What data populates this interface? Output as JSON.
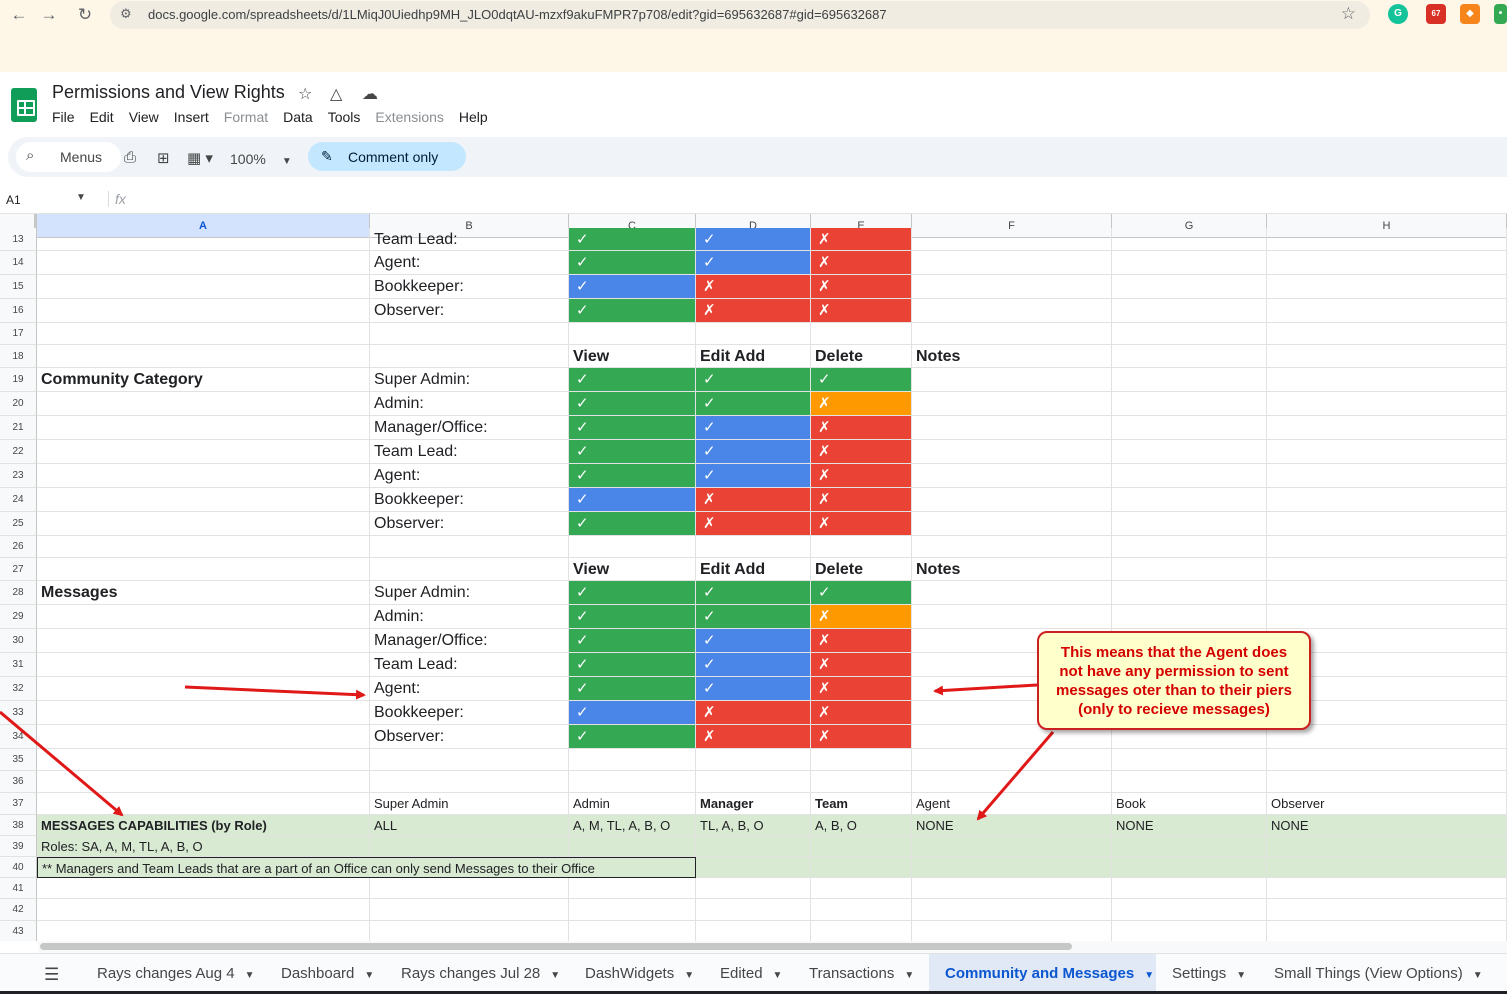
{
  "browser": {
    "url": "docs.google.com/spreadsheets/d/1LMiqJ0Uiedhp9MH_JLO0dqtAU-mzxf9akuFMPR7p708/edit?gid=695632687#gid=695632687",
    "ext_badge": "67"
  },
  "doc": {
    "title": "Permissions and View Rights",
    "menus": [
      {
        "label": "File",
        "enabled": true
      },
      {
        "label": "Edit",
        "enabled": true
      },
      {
        "label": "View",
        "enabled": true
      },
      {
        "label": "Insert",
        "enabled": true
      },
      {
        "label": "Format",
        "enabled": false
      },
      {
        "label": "Data",
        "enabled": true
      },
      {
        "label": "Tools",
        "enabled": true
      },
      {
        "label": "Extensions",
        "enabled": false
      },
      {
        "label": "Help",
        "enabled": true
      }
    ]
  },
  "toolbar": {
    "search_label": "Menus",
    "zoom": "100%",
    "mode_label": "Comment only"
  },
  "formula": {
    "cell_ref": "A1",
    "fx": "fx"
  },
  "colors": {
    "green": "#34a853",
    "blue": "#4a86e8",
    "red": "#ea4335",
    "orange": "#ff9900",
    "light_green": "#d9ead3",
    "callout_text": "#d40000",
    "callout_bg": "#ffffcc",
    "arrow": "#e01818"
  },
  "marks": {
    "yes": "✓",
    "no": "✗"
  },
  "columns": [
    "A",
    "B",
    "C",
    "D",
    "E",
    "F",
    "G",
    "H"
  ],
  "rows": [
    {
      "n": "13",
      "cells": [
        null,
        "Team Lead:",
        [
          "yes",
          "g"
        ],
        [
          "yes",
          "b"
        ],
        [
          "no",
          "r"
        ],
        null,
        null,
        null
      ]
    },
    {
      "n": "14",
      "cells": [
        null,
        "Agent:",
        [
          "yes",
          "g"
        ],
        [
          "yes",
          "b"
        ],
        [
          "no",
          "r"
        ],
        null,
        null,
        null
      ]
    },
    {
      "n": "15",
      "cells": [
        null,
        "Bookkeeper:",
        [
          "yes",
          "b"
        ],
        [
          "no",
          "r"
        ],
        [
          "no",
          "r"
        ],
        null,
        null,
        null
      ]
    },
    {
      "n": "16",
      "cells": [
        null,
        "Observer:",
        [
          "yes",
          "g"
        ],
        [
          "no",
          "r"
        ],
        [
          "no",
          "r"
        ],
        null,
        null,
        null
      ]
    },
    {
      "n": "17",
      "cells": [
        null,
        null,
        null,
        null,
        null,
        null,
        null,
        null
      ]
    },
    {
      "n": "18",
      "cells": [
        null,
        null,
        "View",
        "Edit Add",
        "Delete",
        "Notes",
        null,
        null
      ],
      "bold": true
    },
    {
      "n": "19",
      "cells": [
        "Community Category",
        "Super Admin:",
        [
          "yes",
          "g"
        ],
        [
          "yes",
          "g"
        ],
        [
          "yes",
          "g"
        ],
        null,
        null,
        null
      ],
      "boldA": true
    },
    {
      "n": "20",
      "cells": [
        null,
        "Admin:",
        [
          "yes",
          "g"
        ],
        [
          "yes",
          "g"
        ],
        [
          "no",
          "o"
        ],
        null,
        null,
        null
      ]
    },
    {
      "n": "21",
      "cells": [
        null,
        "Manager/Office:",
        [
          "yes",
          "g"
        ],
        [
          "yes",
          "b"
        ],
        [
          "no",
          "r"
        ],
        null,
        null,
        null
      ]
    },
    {
      "n": "22",
      "cells": [
        null,
        "Team Lead:",
        [
          "yes",
          "g"
        ],
        [
          "yes",
          "b"
        ],
        [
          "no",
          "r"
        ],
        null,
        null,
        null
      ]
    },
    {
      "n": "23",
      "cells": [
        null,
        "Agent:",
        [
          "yes",
          "g"
        ],
        [
          "yes",
          "b"
        ],
        [
          "no",
          "r"
        ],
        null,
        null,
        null
      ]
    },
    {
      "n": "24",
      "cells": [
        null,
        "Bookkeeper:",
        [
          "yes",
          "b"
        ],
        [
          "no",
          "r"
        ],
        [
          "no",
          "r"
        ],
        null,
        null,
        null
      ]
    },
    {
      "n": "25",
      "cells": [
        null,
        "Observer:",
        [
          "yes",
          "g"
        ],
        [
          "no",
          "r"
        ],
        [
          "no",
          "r"
        ],
        null,
        null,
        null
      ]
    },
    {
      "n": "26",
      "cells": [
        null,
        null,
        null,
        null,
        null,
        null,
        null,
        null
      ]
    },
    {
      "n": "27",
      "cells": [
        null,
        null,
        "View",
        "Edit Add",
        "Delete",
        "Notes",
        null,
        null
      ],
      "bold": true
    },
    {
      "n": "28",
      "cells": [
        "Messages",
        "Super Admin:",
        [
          "yes",
          "g"
        ],
        [
          "yes",
          "g"
        ],
        [
          "yes",
          "g"
        ],
        null,
        null,
        null
      ],
      "boldA": true
    },
    {
      "n": "29",
      "cells": [
        null,
        "Admin:",
        [
          "yes",
          "g"
        ],
        [
          "yes",
          "g"
        ],
        [
          "no",
          "o"
        ],
        null,
        null,
        null
      ]
    },
    {
      "n": "30",
      "cells": [
        null,
        "Manager/Office:",
        [
          "yes",
          "g"
        ],
        [
          "yes",
          "b"
        ],
        [
          "no",
          "r"
        ],
        null,
        null,
        null
      ]
    },
    {
      "n": "31",
      "cells": [
        null,
        "Team Lead:",
        [
          "yes",
          "g"
        ],
        [
          "yes",
          "b"
        ],
        [
          "no",
          "r"
        ],
        null,
        null,
        null
      ]
    },
    {
      "n": "32",
      "cells": [
        null,
        "Agent:",
        [
          "yes",
          "g"
        ],
        [
          "yes",
          "b"
        ],
        [
          "no",
          "r"
        ],
        null,
        null,
        null
      ]
    },
    {
      "n": "33",
      "cells": [
        null,
        "Bookkeeper:",
        [
          "yes",
          "b"
        ],
        [
          "no",
          "r"
        ],
        [
          "no",
          "r"
        ],
        null,
        null,
        null
      ]
    },
    {
      "n": "34",
      "cells": [
        null,
        "Observer:",
        [
          "yes",
          "g"
        ],
        [
          "no",
          "r"
        ],
        [
          "no",
          "r"
        ],
        null,
        null,
        null
      ]
    },
    {
      "n": "35",
      "cells": [
        null,
        null,
        null,
        null,
        null,
        null,
        null,
        null
      ]
    },
    {
      "n": "36",
      "cells": [
        null,
        null,
        null,
        null,
        null,
        null,
        null,
        null
      ]
    },
    {
      "n": "37",
      "cells": [
        null,
        "Super Admin",
        "Admin",
        "Manager",
        "Team",
        "Agent",
        "Book",
        "Observer"
      ],
      "small": true,
      "boldCols": [
        3,
        4
      ]
    },
    {
      "n": "38",
      "cells": [
        "MESSAGES CAPABILITIES (by Role)",
        "ALL",
        "A, M, TL, A, B, O",
        "TL, A, B, O",
        "A, B, O",
        "NONE",
        "NONE",
        "NONE"
      ],
      "small": true,
      "bg": "lg",
      "boldA": true
    },
    {
      "n": "39",
      "cells": [
        "Roles: SA, A, M, TL, A, B, O",
        null,
        null,
        null,
        null,
        null,
        null,
        null
      ],
      "small": true,
      "bg": "lg"
    },
    {
      "n": "40",
      "cells": [
        "** Managers and Team Leads that are a part of an Office can only send Messages to their Office",
        null,
        null,
        null,
        null,
        null,
        null,
        null
      ],
      "small": true,
      "bg": "lg",
      "boxed": true
    },
    {
      "n": "41",
      "cells": [
        null,
        null,
        null,
        null,
        null,
        null,
        null,
        null
      ]
    },
    {
      "n": "42",
      "cells": [
        null,
        null,
        null,
        null,
        null,
        null,
        null,
        null
      ]
    },
    {
      "n": "43",
      "cells": [
        null,
        null,
        null,
        null,
        null,
        null,
        null,
        null
      ]
    }
  ],
  "callout": {
    "lines": [
      "This means that the Agent does",
      "not have any permission to sent",
      "messages oter than to their piers",
      "(only to recieve messages)"
    ]
  },
  "tabs": [
    {
      "label": "Rays changes Aug 4",
      "active": false
    },
    {
      "label": "Dashboard",
      "active": false
    },
    {
      "label": "Rays changes Jul 28",
      "active": false
    },
    {
      "label": "DashWidgets",
      "active": false
    },
    {
      "label": "Edited",
      "active": false
    },
    {
      "label": "Transactions",
      "active": false
    },
    {
      "label": "Community and Messages",
      "active": true
    },
    {
      "label": "Settings",
      "active": false
    },
    {
      "label": "Small Things (View Options)",
      "active": false
    }
  ]
}
